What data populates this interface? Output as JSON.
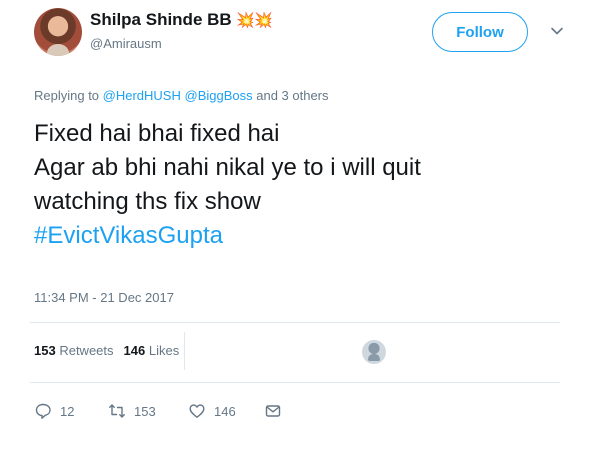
{
  "tweet": {
    "author": {
      "display_name": "Shilpa Shinde BB",
      "name_emoji": "💥💥",
      "handle": "@Amirausm"
    },
    "follow_label": "Follow",
    "reply": {
      "prefix": "Replying to ",
      "mention1": "@HerdHUSH",
      "mention2": "@BiggBoss",
      "suffix": " and 3 others"
    },
    "text_lines": [
      "Fixed hai bhai fixed hai",
      "Agar ab bhi nahi nikal ye to i will quit",
      "watching ths fix show"
    ],
    "hashtag": "#EvictVikasGupta",
    "timestamp": "11:34 PM - 21 Dec 2017",
    "stats": {
      "retweets_count": "153",
      "retweets_label": "Retweets",
      "likes_count": "146",
      "likes_label": "Likes"
    },
    "actions": {
      "reply_count": "12",
      "retweet_count": "153",
      "like_count": "146"
    }
  },
  "colors": {
    "accent": "#1da1f2",
    "muted": "#657786",
    "text": "#14171a",
    "divider": "#e1e8ed"
  }
}
